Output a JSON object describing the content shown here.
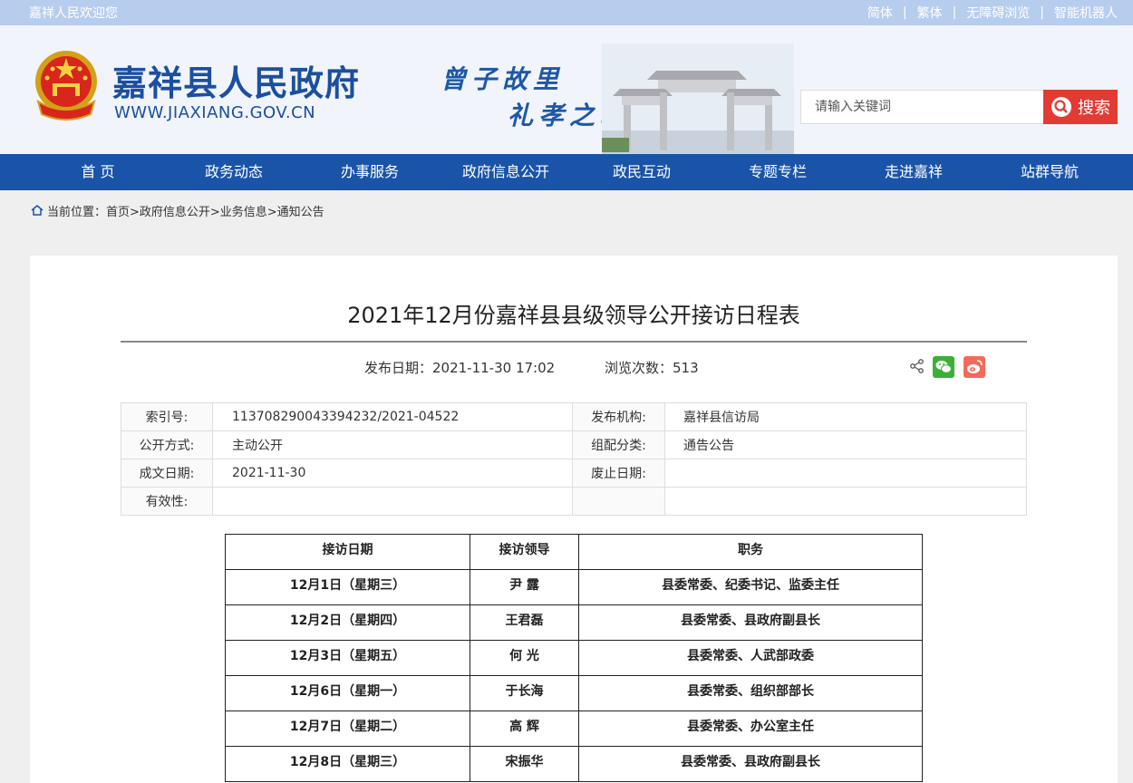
{
  "topbar": {
    "welcome": "嘉祥人民欢迎您",
    "links": [
      "简体",
      "繁体",
      "无障碍浏览",
      "智能机器人"
    ],
    "separator": "|"
  },
  "header": {
    "site_title": "嘉祥县人民政府",
    "site_url": "WWW.JIAXIANG.GOV.CN",
    "slogan_line1": "曾子故里",
    "slogan_line2": "礼孝之城",
    "search_placeholder": "请输入关键词",
    "search_button": "搜索"
  },
  "nav": [
    "首 页",
    "政务动态",
    "办事服务",
    "政府信息公开",
    "政民互动",
    "专题专栏",
    "走进嘉祥",
    "站群导航"
  ],
  "breadcrumb": "当前位置：首页>政府信息公开>业务信息>通知公告",
  "article": {
    "title": "2021年12月份嘉祥县县级领导公开接访日程表",
    "publish_date": "发布日期：2021-11-30 17:02",
    "views": "浏览次数：513"
  },
  "info": {
    "index_label": "索引号:",
    "index_value": "113708290043394232/2021-04522",
    "publisher_label": "发布机构:",
    "publisher_value": "嘉祥县信访局",
    "open_label": "公开方式:",
    "open_value": "主动公开",
    "category_label": "组配分类:",
    "category_value": "通告公告",
    "date_label": "成文日期:",
    "date_value": "2021-11-30",
    "expire_label": "废止日期:",
    "expire_value": "",
    "valid_label": "有效性:",
    "valid_value": ""
  },
  "schedule": {
    "headers": [
      "接访日期",
      "接访领导",
      "职务"
    ],
    "rows": [
      [
        "12月1日（星期三）",
        "尹  露",
        "县委常委、纪委书记、监委主任"
      ],
      [
        "12月2日（星期四）",
        "王君磊",
        "县委常委、县政府副县长"
      ],
      [
        "12月3日（星期五）",
        "何  光",
        "县委常委、人武部政委"
      ],
      [
        "12月6日（星期一）",
        "于长海",
        "县委常委、组织部部长"
      ],
      [
        "12月7日（星期二）",
        "高  辉",
        "县委常委、办公室主任"
      ],
      [
        "12月8日（星期三）",
        "宋振华",
        "县委常委、县政府副县长"
      ]
    ]
  },
  "icons": [
    "home-icon",
    "search-icon",
    "share-icon",
    "wechat-icon",
    "weibo-icon",
    "national-emblem-icon"
  ],
  "colors": {
    "nav": "#1a54a8",
    "search_button": "#e23b33",
    "topbar": "#b7cdee",
    "title_blue": "#1b4fa0"
  }
}
